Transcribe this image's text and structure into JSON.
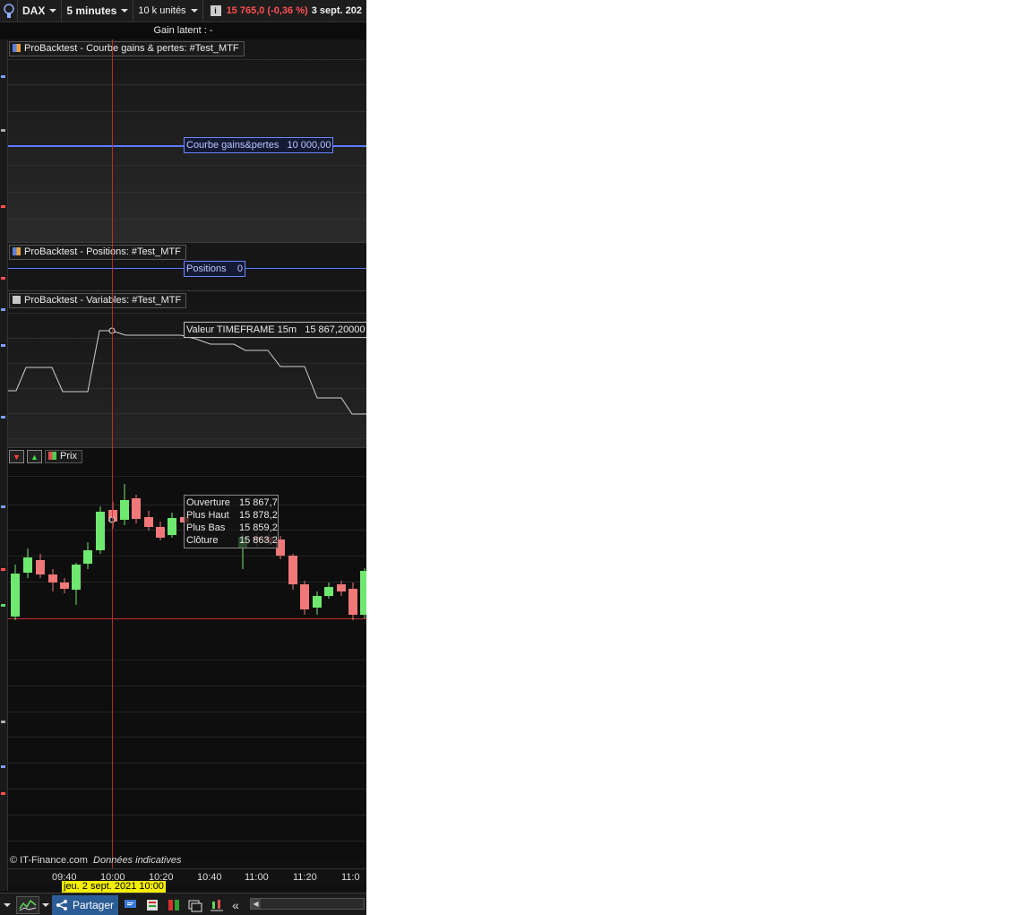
{
  "toolbar": {
    "instrument": "DAX",
    "timeframe": "5 minutes",
    "units": "10 k unités",
    "info_icon": "i",
    "price_change": "15 765,0 (-0,36 %)",
    "date": "3 sept. 202"
  },
  "gain_latent": "Gain latent :  -",
  "panels": {
    "pnl": {
      "title": "ProBacktest - Courbe gains & pertes: #Test_MTF",
      "label_name": "Courbe gains&pertes",
      "label_value": "10 000,00",
      "swatch_colors": [
        "#e9a040",
        "#5b7fd8"
      ]
    },
    "positions": {
      "title": "ProBacktest - Positions: #Test_MTF",
      "label_name": "Positions",
      "label_value": "0"
    },
    "variables": {
      "title": "ProBacktest - Variables: #Test_MTF",
      "label_name": "Valeur TIMEFRAME 15m",
      "label_value": "15 867,20000"
    },
    "price": {
      "title": "Prix",
      "ohlc": [
        {
          "key": "Ouverture",
          "value": "15 867,7"
        },
        {
          "key": "Plus Haut",
          "value": "15 878,2"
        },
        {
          "key": "Plus Bas",
          "value": "15 859,2"
        },
        {
          "key": "Clôture",
          "value": "15 863,2"
        }
      ]
    }
  },
  "credit": {
    "source": "© IT-Finance.com",
    "note": "Données indicatives"
  },
  "time_axis": {
    "labels": [
      "09:40",
      "10:00",
      "10:20",
      "10:40",
      "11:00",
      "11:20",
      "11:0"
    ],
    "cursor_date": "jeu. 2 sept. 2021 10:00"
  },
  "bottombar": {
    "share_label": "Partager",
    "collapse": "«"
  },
  "colors": {
    "up": "#6ee86e",
    "down": "#f07878",
    "cursor": "#ff3030",
    "line_blue": "#5b7bff",
    "line_var": "#cfcfcf"
  }
}
